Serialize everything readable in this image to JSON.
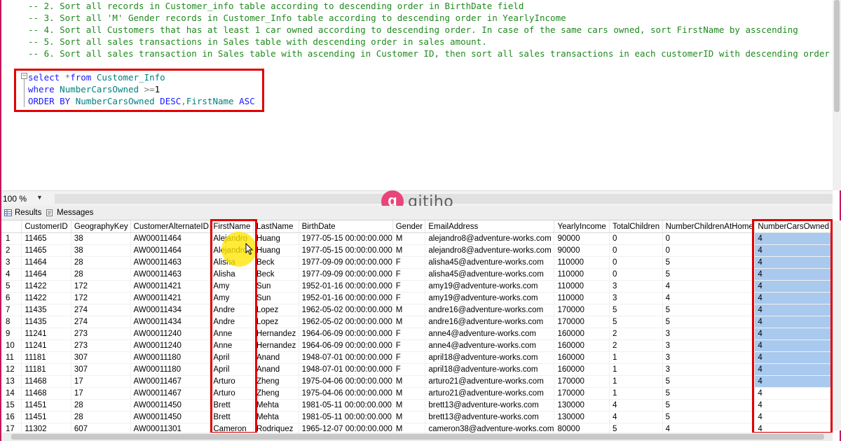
{
  "editor": {
    "comments": [
      "-- 2. Sort all records in Customer_info table according to descending order in BirthDate field",
      "-- 3. Sort all 'M' Gender records in Customer_Info table according to descending order in YearlyIncome",
      "-- 4. Sort all Customers that has at least 1 car owned according to descending order. In case of the same cars owned, sort FirstName by asscending",
      "-- 5. Sort all sales transactions in Sales table with descending order in sales amount.",
      "-- 6. Sort all sales transaction in Sales table with ascending in Customer ID, then sort all sales transactions in each customerID with descending order"
    ],
    "query": {
      "l1_kw": "select",
      "l1_op": " *",
      "l1_kw2": "from",
      "l1_obj": " Customer_Info",
      "l2_kw": "where",
      "l2_obj": " NumberCarsOwned",
      "l2_op": " >=",
      "l2_val": "1",
      "l3_kw": "ORDER BY",
      "l3_obj": " NumberCarsOwned",
      "l3_kw2": " DESC",
      "l3_op": ",",
      "l3_obj2": "FirstName",
      "l3_kw3": " ASC"
    }
  },
  "zoom": {
    "value": "100 %"
  },
  "logo": {
    "mark": "g",
    "text": "gitiho",
    "color": "#e8457a"
  },
  "tabs": {
    "results": "Results",
    "messages": "Messages"
  },
  "grid": {
    "columns": [
      "",
      "CustomerID",
      "GeographyKey",
      "CustomerAlternateID",
      "FirstName",
      "LastName",
      "BirthDate",
      "Gender",
      "EmailAddress",
      "YearlyIncome",
      "TotalChildren",
      "NumberChildrenAtHome",
      "NumberCarsOwned"
    ],
    "rows": [
      [
        "1",
        "11465",
        "38",
        "AW00011464",
        "Alejandro",
        "Huang",
        "1977-05-15 00:00:00.000",
        "M",
        "alejandro8@adventure-works.com",
        "90000",
        "0",
        "0",
        "4"
      ],
      [
        "2",
        "11465",
        "38",
        "AW00011464",
        "Alejandro",
        "Huang",
        "1977-05-15 00:00:00.000",
        "M",
        "alejandro8@adventure-works.com",
        "90000",
        "0",
        "0",
        "4"
      ],
      [
        "3",
        "11464",
        "28",
        "AW00011463",
        "Alisha",
        "Beck",
        "1977-09-09 00:00:00.000",
        "F",
        "alisha45@adventure-works.com",
        "110000",
        "0",
        "5",
        "4"
      ],
      [
        "4",
        "11464",
        "28",
        "AW00011463",
        "Alisha",
        "Beck",
        "1977-09-09 00:00:00.000",
        "F",
        "alisha45@adventure-works.com",
        "110000",
        "0",
        "5",
        "4"
      ],
      [
        "5",
        "11422",
        "172",
        "AW00011421",
        "Amy",
        "Sun",
        "1952-01-16 00:00:00.000",
        "F",
        "amy19@adventure-works.com",
        "110000",
        "3",
        "4",
        "4"
      ],
      [
        "6",
        "11422",
        "172",
        "AW00011421",
        "Amy",
        "Sun",
        "1952-01-16 00:00:00.000",
        "F",
        "amy19@adventure-works.com",
        "110000",
        "3",
        "4",
        "4"
      ],
      [
        "7",
        "11435",
        "274",
        "AW00011434",
        "Andre",
        "Lopez",
        "1962-05-02 00:00:00.000",
        "M",
        "andre16@adventure-works.com",
        "170000",
        "5",
        "5",
        "4"
      ],
      [
        "8",
        "11435",
        "274",
        "AW00011434",
        "Andre",
        "Lopez",
        "1962-05-02 00:00:00.000",
        "M",
        "andre16@adventure-works.com",
        "170000",
        "5",
        "5",
        "4"
      ],
      [
        "9",
        "11241",
        "273",
        "AW00011240",
        "Anne",
        "Hernandez",
        "1964-06-09 00:00:00.000",
        "F",
        "anne4@adventure-works.com",
        "160000",
        "2",
        "3",
        "4"
      ],
      [
        "10",
        "11241",
        "273",
        "AW00011240",
        "Anne",
        "Hernandez",
        "1964-06-09 00:00:00.000",
        "F",
        "anne4@adventure-works.com",
        "160000",
        "2",
        "3",
        "4"
      ],
      [
        "11",
        "11181",
        "307",
        "AW00011180",
        "April",
        "Anand",
        "1948-07-01 00:00:00.000",
        "F",
        "april18@adventure-works.com",
        "160000",
        "1",
        "3",
        "4"
      ],
      [
        "12",
        "11181",
        "307",
        "AW00011180",
        "April",
        "Anand",
        "1948-07-01 00:00:00.000",
        "F",
        "april18@adventure-works.com",
        "160000",
        "1",
        "3",
        "4"
      ],
      [
        "13",
        "11468",
        "17",
        "AW00011467",
        "Arturo",
        "Zheng",
        "1975-04-06 00:00:00.000",
        "M",
        "arturo21@adventure-works.com",
        "170000",
        "1",
        "5",
        "4"
      ],
      [
        "14",
        "11468",
        "17",
        "AW00011467",
        "Arturo",
        "Zheng",
        "1975-04-06 00:00:00.000",
        "M",
        "arturo21@adventure-works.com",
        "170000",
        "1",
        "5",
        "4"
      ],
      [
        "15",
        "11451",
        "28",
        "AW00011450",
        "Brett",
        "Mehta",
        "1981-05-11 00:00:00.000",
        "M",
        "brett13@adventure-works.com",
        "130000",
        "4",
        "5",
        "4"
      ],
      [
        "16",
        "11451",
        "28",
        "AW00011450",
        "Brett",
        "Mehta",
        "1981-05-11 00:00:00.000",
        "M",
        "brett13@adventure-works.com",
        "130000",
        "4",
        "5",
        "4"
      ],
      [
        "17",
        "11302",
        "607",
        "AW00011301",
        "Cameron",
        "Rodriquez",
        "1965-12-07 00:00:00.000",
        "M",
        "cameron38@adventure-works.com",
        "80000",
        "5",
        "4",
        "4"
      ]
    ],
    "selected_rows_in_last_column": 13,
    "selection_color": "#a9c9ee"
  },
  "highlight_color": "#e00000"
}
